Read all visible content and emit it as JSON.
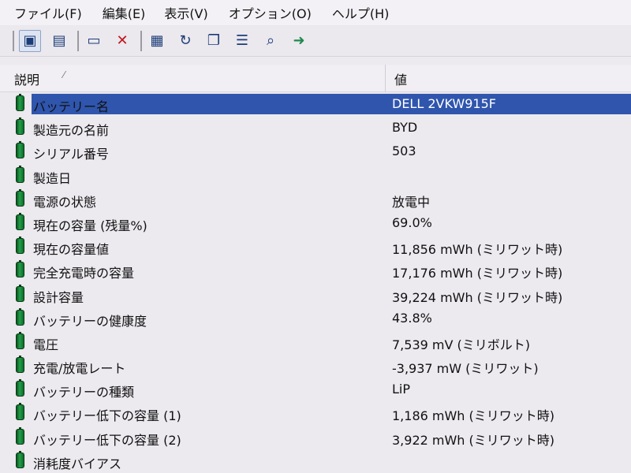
{
  "menu": [
    "ファイル(F)",
    "編集(E)",
    "表示(V)",
    "オプション(O)",
    "ヘルプ(H)"
  ],
  "toolbar": {
    "icons": [
      "view-icon",
      "clipboard-icon",
      "window-icon",
      "delete-icon",
      "save-icon",
      "refresh-icon",
      "copy-icon",
      "properties-icon",
      "find-icon",
      "exit-icon"
    ]
  },
  "header": {
    "col1": "説明",
    "col2": "値"
  },
  "rows": [
    {
      "label": "バッテリー名",
      "value": "DELL 2VKW915F"
    },
    {
      "label": "製造元の名前",
      "value": "BYD"
    },
    {
      "label": "シリアル番号",
      "value": "503"
    },
    {
      "label": "製造日",
      "value": ""
    },
    {
      "label": "電源の状態",
      "value": "放電中"
    },
    {
      "label": "現在の容量 (残量%)",
      "value": "69.0%"
    },
    {
      "label": "現在の容量値",
      "value": "11,856 mWh (ミリワット時)"
    },
    {
      "label": "完全充電時の容量",
      "value": "17,176 mWh (ミリワット時)"
    },
    {
      "label": "設計容量",
      "value": "39,224 mWh (ミリワット時)"
    },
    {
      "label": "バッテリーの健康度",
      "value": "43.8%"
    },
    {
      "label": "電圧",
      "value": "7,539 mV (ミリボルト)"
    },
    {
      "label": "充電/放電レート",
      "value": "-3,937 mW (ミリワット)"
    },
    {
      "label": "バッテリーの種類",
      "value": "LiP"
    },
    {
      "label": "バッテリー低下の容量 (1)",
      "value": "1,186 mWh (ミリワット時)"
    },
    {
      "label": "バッテリー低下の容量 (2)",
      "value": "3,922 mWh (ミリワット時)"
    },
    {
      "label": "消耗度バイアス",
      "value": ""
    }
  ],
  "colors": {
    "selection": "#2f55ad",
    "battery_icon": "#22a04a"
  }
}
